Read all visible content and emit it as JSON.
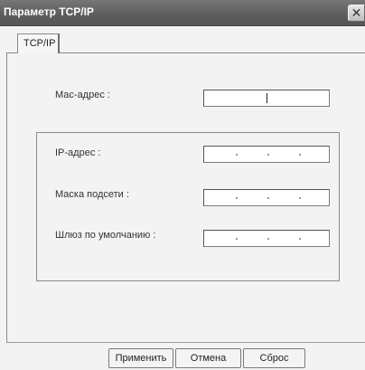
{
  "window": {
    "title": "Параметр TCP/IP",
    "close_glyph": "✕"
  },
  "tabs": [
    {
      "label": "TCP/IP",
      "active": true
    }
  ],
  "fields": {
    "mac": {
      "label": "Мас-адрес :",
      "value": ""
    },
    "ip": {
      "label": "IP-адрес :",
      "value": ""
    },
    "mask": {
      "label": "Маска подсети :",
      "value": ""
    },
    "gateway": {
      "label": "Шлюз по умолчанию :",
      "value": ""
    }
  },
  "buttons": {
    "apply": "Применить",
    "cancel": "Отмена",
    "reset": "Сброс"
  },
  "colors": {
    "titlebar": "#5e5e5e",
    "client_bg": "#f3f3f3"
  }
}
